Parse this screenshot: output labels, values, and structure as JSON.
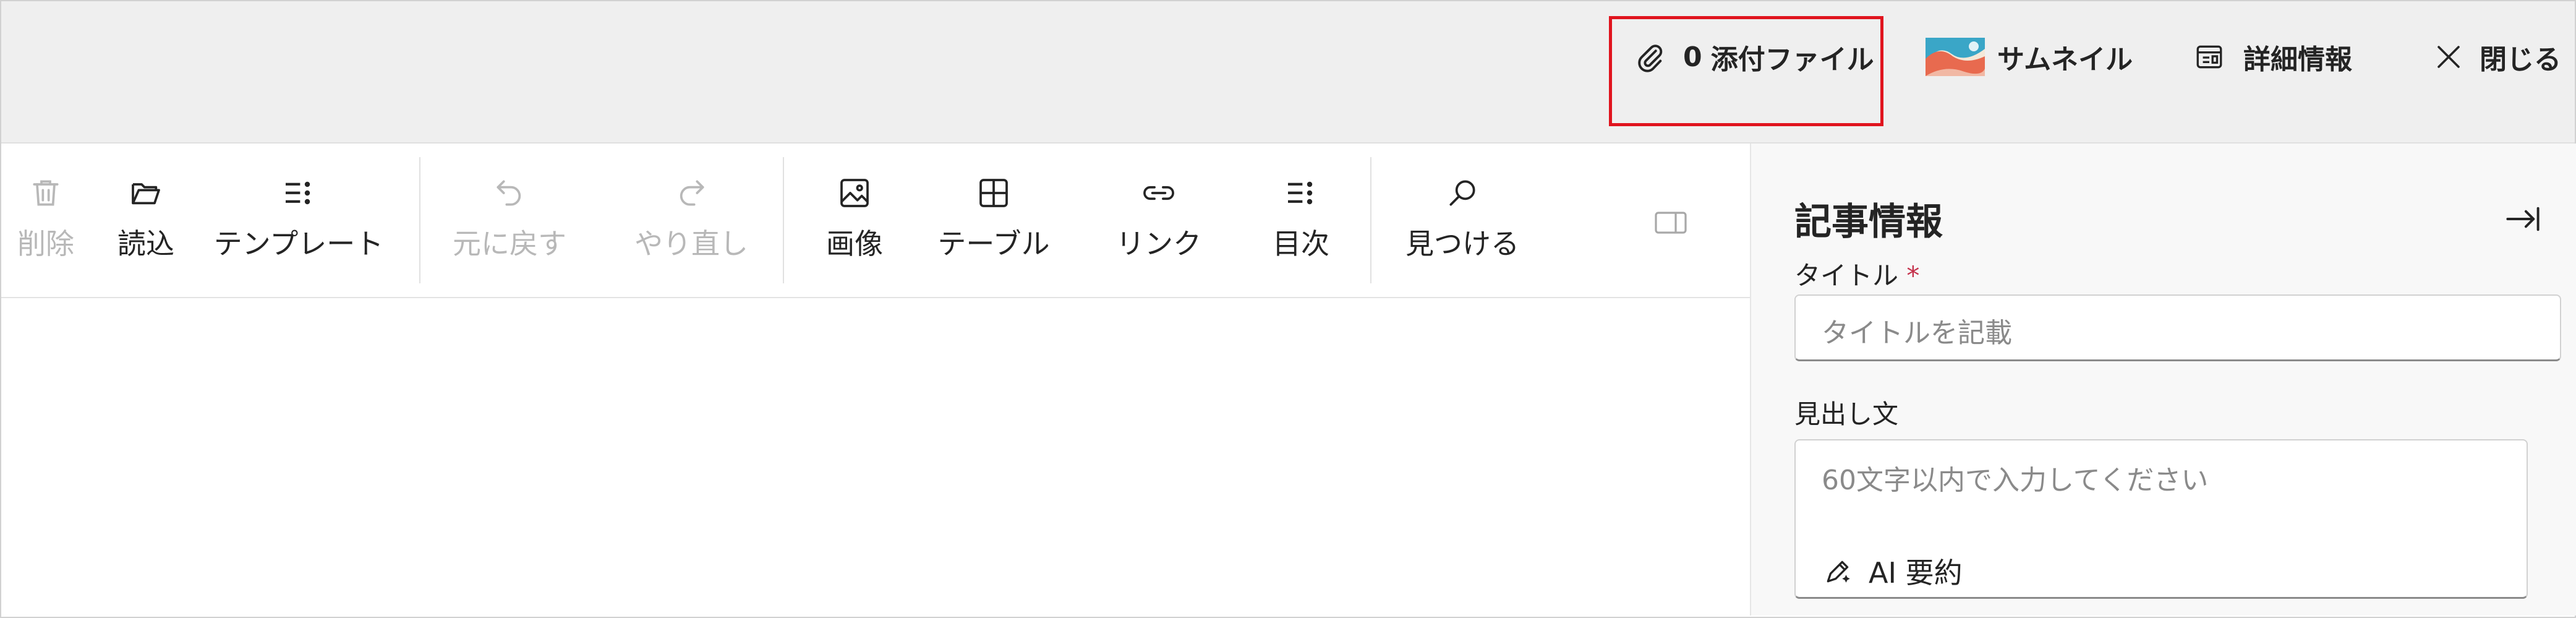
{
  "header": {
    "attachments": {
      "count": "0",
      "label": "添付ファイル"
    },
    "thumbnail_label": "サムネイル",
    "details_label": "詳細情報",
    "close_label": "閉じる"
  },
  "toolbar": {
    "delete_label": "削除",
    "load_label": "読込",
    "template_label": "テンプレート",
    "undo_label": "元に戻す",
    "redo_label": "やり直し",
    "image_label": "画像",
    "table_label": "テーブル",
    "link_label": "リンク",
    "toc_label": "目次",
    "find_label": "見つける"
  },
  "panel": {
    "title": "記事情報",
    "title_field": {
      "label": "タイトル",
      "required_mark": "*",
      "placeholder": "タイトルを記載"
    },
    "summary_field": {
      "label": "見出し文",
      "placeholder": "60文字以内で入力してください",
      "ai_button_label": "AI 要約"
    }
  },
  "colors": {
    "highlight_border": "#e0141e",
    "required": "#c4314b",
    "header_bg": "#efefef",
    "panel_bg": "#f8f8f8"
  },
  "icons": [
    "paperclip-icon",
    "thumbnail-image-icon",
    "details-icon",
    "close-icon",
    "trash-icon",
    "folder-open-icon",
    "template-list-icon",
    "undo-icon",
    "redo-icon",
    "image-icon",
    "table-icon",
    "link-icon",
    "toc-list-icon",
    "search-icon",
    "sidebar-toggle-icon",
    "collapse-panel-icon",
    "ai-pen-icon"
  ]
}
